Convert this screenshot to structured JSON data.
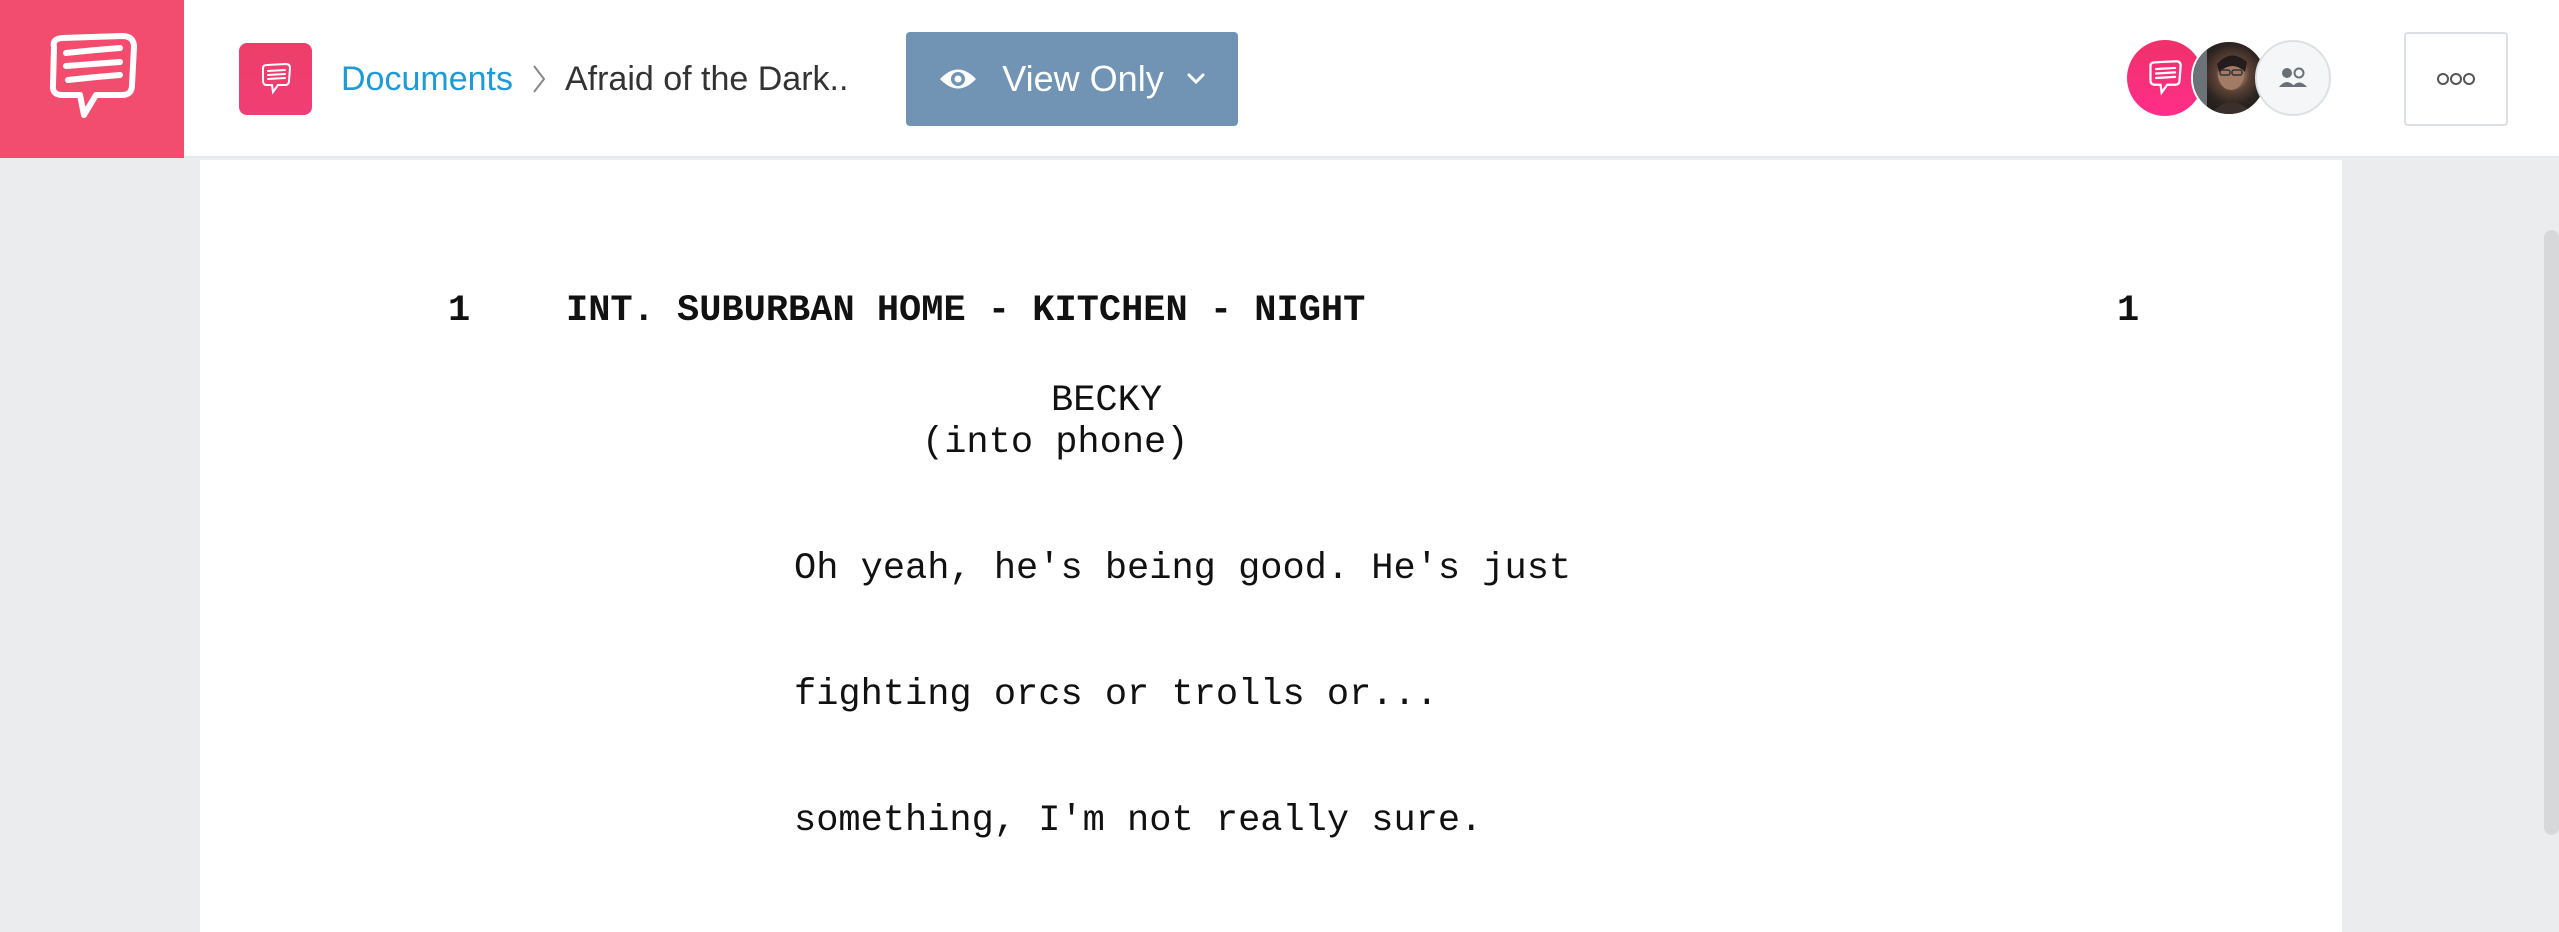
{
  "header": {
    "logo": "speech-bubble-logo",
    "breadcrumb": {
      "root_label": "Documents",
      "separator": "chevron-right",
      "current_label": "Afraid of the Dark.."
    },
    "view_mode_button": {
      "label": "View Only",
      "icon": "eye-icon",
      "dropdown_icon": "chevron-down-icon"
    },
    "collaborators": [
      {
        "type": "brand",
        "icon": "speech-bubble-icon"
      },
      {
        "type": "photo",
        "icon": "user-photo"
      },
      {
        "type": "group",
        "icon": "users-icon"
      }
    ],
    "more_button": {
      "icon": "more-options-icon"
    },
    "colors": {
      "brand": "#F24C6E",
      "link": "#1E9AD6",
      "view_button": "#7193B4"
    }
  },
  "document": {
    "scene": {
      "number_left": "1",
      "heading": "INT. SUBURBAN HOME - KITCHEN - NIGHT",
      "number_right": "1"
    },
    "character": "BECKY",
    "parenthetical": "(into phone)",
    "dialogue": [
      "Oh yeah, he's being good. He's just",
      "fighting orcs or trolls or...",
      "something, I'm not really sure."
    ]
  }
}
